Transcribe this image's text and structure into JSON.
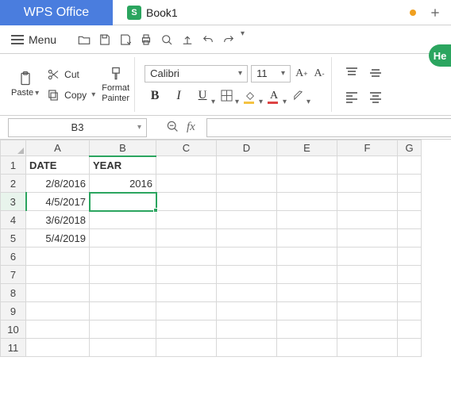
{
  "app": {
    "brand": "WPS Office"
  },
  "tab": {
    "icon_letter": "S",
    "title": "Book1"
  },
  "help": {
    "label": "He"
  },
  "menu": {
    "label": "Menu"
  },
  "ribbon": {
    "paste": "Paste",
    "cut": "Cut",
    "copy": "Copy",
    "format_painter_l1": "Format",
    "format_painter_l2": "Painter",
    "font_name": "Calibri",
    "font_size": "11"
  },
  "formula": {
    "namebox": "B3",
    "fx": "fx",
    "value": ""
  },
  "columns": [
    "A",
    "B",
    "C",
    "D",
    "E",
    "F",
    "G"
  ],
  "rows": [
    "1",
    "2",
    "3",
    "4",
    "5",
    "6",
    "7",
    "8",
    "9",
    "10",
    "11"
  ],
  "cells": {
    "A1": "DATE",
    "B1": "YEAR",
    "A2": "2/8/2016",
    "B2": "2016",
    "A3": "4/5/2017",
    "A4": "3/6/2018",
    "A5": "5/4/2019"
  },
  "selected": {
    "col": "B",
    "row": "3"
  }
}
